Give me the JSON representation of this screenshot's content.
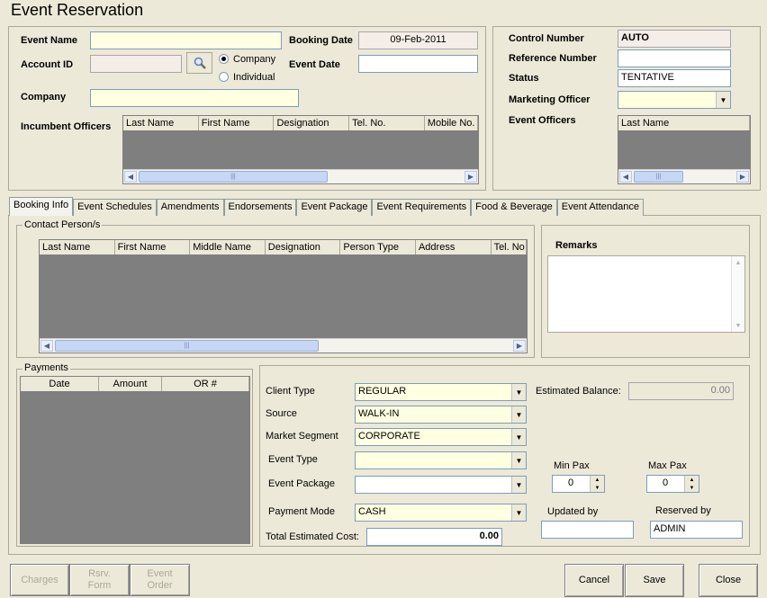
{
  "window": {
    "title": "Event Reservation"
  },
  "header_left": {
    "event_name_label": "Event Name",
    "event_name_value": "",
    "booking_date_label": "Booking Date",
    "booking_date_value": "09-Feb-2011",
    "account_id_label": "Account ID",
    "account_id_value": "",
    "radio_company": "Company",
    "radio_individual": "Individual",
    "radio_selected": "Company",
    "event_date_label": "Event Date",
    "event_date_value": "",
    "company_label": "Company",
    "company_value": "",
    "incumbent_label": "Incumbent Officers",
    "incumbent_columns": [
      "Last Name",
      "First Name",
      "Designation",
      "Tel. No.",
      "Mobile No."
    ]
  },
  "header_right": {
    "control_number_label": "Control Number",
    "control_number_value": "AUTO",
    "reference_number_label": "Reference Number",
    "reference_number_value": "",
    "status_label": "Status",
    "status_value": "TENTATIVE",
    "marketing_officer_label": "Marketing Officer",
    "marketing_officer_value": "",
    "event_officers_label": "Event Officers",
    "event_officers_columns": [
      "Last Name"
    ]
  },
  "tabs": [
    {
      "label": "Booking Info",
      "active": true
    },
    {
      "label": "Event Schedules"
    },
    {
      "label": "Amendments"
    },
    {
      "label": "Endorsements"
    },
    {
      "label": "Event Package"
    },
    {
      "label": "Event Requirements"
    },
    {
      "label": "Food & Beverage"
    },
    {
      "label": "Event Attendance"
    }
  ],
  "booking_info": {
    "contact_title": "Contact Person/s",
    "contact_columns": [
      "Last Name",
      "First Name",
      "Middle Name",
      "Designation",
      "Person Type",
      "Address",
      "Tel. No"
    ],
    "remarks_label": "Remarks",
    "payments_title": "Payments",
    "payments_columns": [
      "Date",
      "Amount",
      "OR #"
    ],
    "client_type_label": "Client Type",
    "client_type_value": "REGULAR",
    "source_label": "Source",
    "source_value": "WALK-IN",
    "market_segment_label": "Market Segment",
    "market_segment_value": "CORPORATE",
    "event_type_label": "Event Type",
    "event_type_value": "",
    "event_package_label": "Event Package",
    "event_package_value": "",
    "payment_mode_label": "Payment Mode",
    "payment_mode_value": "CASH",
    "total_cost_label": "Total Estimated Cost:",
    "total_cost_value": "0.00",
    "estimated_balance_label": "Estimated Balance:",
    "estimated_balance_value": "0.00",
    "min_pax_label": "Min Pax",
    "min_pax_value": "0",
    "max_pax_label": "Max Pax",
    "max_pax_value": "0",
    "updated_by_label": "Updated by",
    "updated_by_value": "",
    "reserved_by_label": "Reserved by",
    "reserved_by_value": "ADMIN"
  },
  "footer": {
    "charges": "Charges",
    "rsrv_form_1": "Rsrv.",
    "rsrv_form_2": "Form",
    "event_order_1": "Event",
    "event_order_2": "Order",
    "cancel": "Cancel",
    "save": "Save",
    "close": "Close"
  },
  "colors": {
    "window_bg": "#ece9d8",
    "input_yellow": "#ffffe1",
    "grid_grey": "#807f80"
  }
}
